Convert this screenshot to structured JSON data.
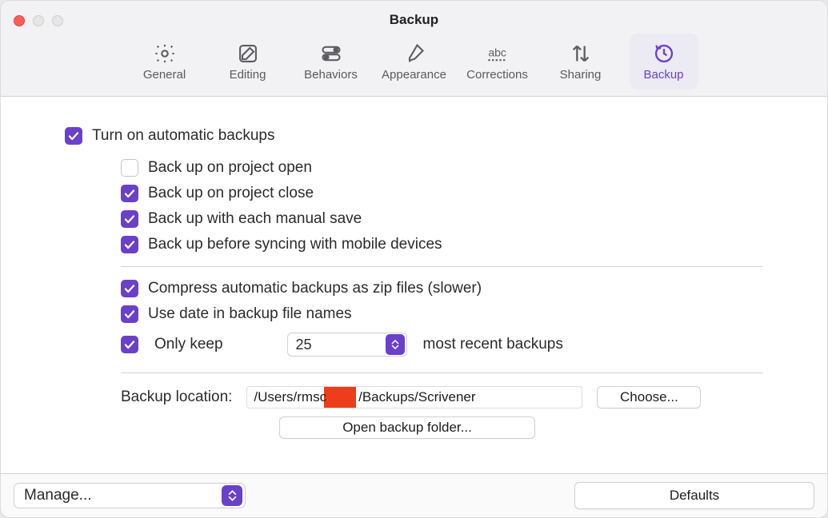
{
  "window": {
    "title": "Backup"
  },
  "tabs": [
    {
      "label": "General"
    },
    {
      "label": "Editing"
    },
    {
      "label": "Behaviors"
    },
    {
      "label": "Appearance"
    },
    {
      "label": "Corrections"
    },
    {
      "label": "Sharing"
    },
    {
      "label": "Backup"
    }
  ],
  "options": {
    "auto": "Turn on automatic backups",
    "on_open": "Back up on project open",
    "on_close": "Back up on project close",
    "on_save": "Back up with each manual save",
    "before_sync": "Back up before syncing with mobile devices",
    "compress": "Compress automatic backups as zip files (slower)",
    "use_date": "Use date in backup file names",
    "only_keep": "Only keep",
    "only_keep_suffix": "most recent backups",
    "keep_count": "25",
    "location_label": "Backup location:",
    "path_prefix": "/Users/rmsc",
    "path_suffix": "/Backups/Scrivener",
    "choose": "Choose...",
    "open_folder": "Open backup folder..."
  },
  "checked": {
    "auto": true,
    "on_open": false,
    "on_close": true,
    "on_save": true,
    "before_sync": true,
    "compress": true,
    "use_date": true,
    "only_keep": true
  },
  "footer": {
    "manage": "Manage...",
    "defaults": "Defaults"
  }
}
